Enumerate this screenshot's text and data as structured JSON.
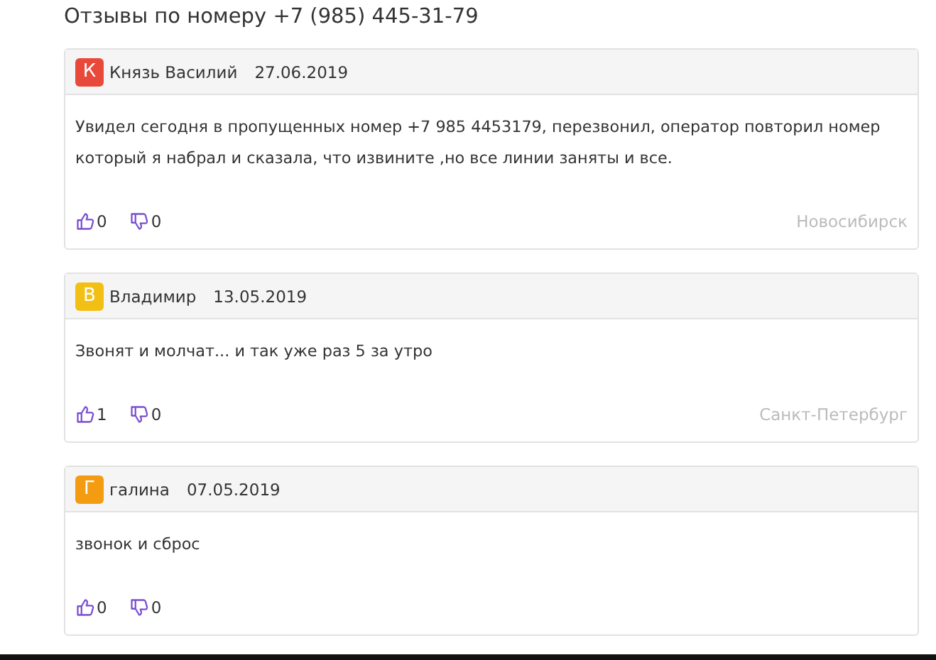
{
  "title": "Отзывы по номеру +7 (985) 445-31-79",
  "reviews": [
    {
      "initial": "К",
      "color": "#e8493b",
      "author": "Князь Василий",
      "date": "27.06.2019",
      "text": "Увидел сегодня в пропущенных номер +7 985 4453179, перезвонил, оператор повторил номер который я набрал и сказала, что извините ,но все линии заняты и все.",
      "likes": "0",
      "dislikes": "0",
      "city": "Новосибирск"
    },
    {
      "initial": "В",
      "color": "#f2c014",
      "author": "Владимир",
      "date": "13.05.2019",
      "text": "Звонят и молчат... и так уже раз 5 за утро",
      "likes": "1",
      "dislikes": "0",
      "city": "Санкт-Петербург"
    },
    {
      "initial": "Г",
      "color": "#f39c12",
      "author": "галина",
      "date": "07.05.2019",
      "text": "звонок и сброс",
      "likes": "0",
      "dislikes": "0"
    }
  ]
}
